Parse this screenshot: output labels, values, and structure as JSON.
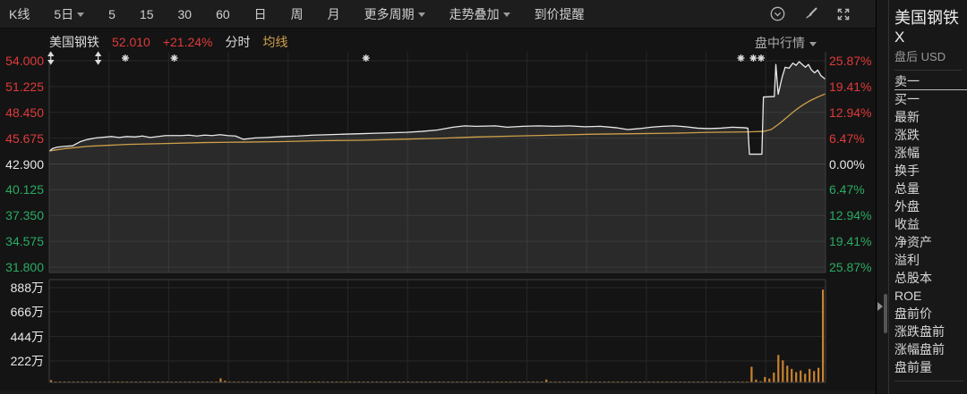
{
  "toolbar": {
    "items": [
      {
        "label": "K线",
        "chevron": false
      },
      {
        "label": "5日",
        "chevron": true
      },
      {
        "label": "5",
        "chevron": false
      },
      {
        "label": "15",
        "chevron": false
      },
      {
        "label": "30",
        "chevron": false
      },
      {
        "label": "60",
        "chevron": false
      },
      {
        "label": "日",
        "chevron": false
      },
      {
        "label": "周",
        "chevron": false
      },
      {
        "label": "月",
        "chevron": false
      },
      {
        "label": "更多周期",
        "chevron": true
      },
      {
        "label": "走势叠加",
        "chevron": true
      },
      {
        "label": "到价提醒",
        "chevron": false
      }
    ],
    "icons": [
      "notify-circle-icon",
      "brush-icon",
      "fullscreen-icon"
    ]
  },
  "chart_header": {
    "stock_name": "美国钢铁",
    "price": "52.010",
    "change_percent": "+21.24%",
    "mode_label": "分时",
    "ma_label": "均线",
    "session_view_label": "盘中行情"
  },
  "colors": {
    "up": "#e03a3a",
    "down": "#2bab63",
    "neutral": "#e8e8e8",
    "ma_line": "#cfa04a",
    "price_line": "#eaeaea",
    "volume_bar": "#c9832e"
  },
  "chart_data": {
    "type": "line",
    "title": "美国钢铁 分时 (intraday minute line)",
    "prev_close": 42.9,
    "last_price": 52.01,
    "change_percent": "+21.24%",
    "y_axis_price": [
      "54.000",
      "51.225",
      "48.450",
      "45.675",
      "42.900",
      "40.125",
      "37.350",
      "34.575",
      "31.800"
    ],
    "y_axis_percent": [
      "25.87%",
      "19.41%",
      "12.94%",
      "6.47%",
      "0.00%",
      "6.47%",
      "12.94%",
      "19.41%",
      "25.87%"
    ],
    "volume_axis_labels": [
      "888万",
      "666万",
      "444万",
      "222万"
    ],
    "ylim": [
      31.8,
      54.0
    ],
    "volume_ylim_wan": [
      0,
      888
    ],
    "grid": true,
    "price_series": [
      [
        0,
        44.25
      ],
      [
        0.004,
        44.55
      ],
      [
        0.01,
        44.7
      ],
      [
        0.02,
        44.8
      ],
      [
        0.03,
        44.85
      ],
      [
        0.04,
        45.3
      ],
      [
        0.05,
        45.55
      ],
      [
        0.06,
        45.7
      ],
      [
        0.08,
        45.85
      ],
      [
        0.09,
        45.75
      ],
      [
        0.1,
        45.85
      ],
      [
        0.11,
        45.8
      ],
      [
        0.12,
        45.9
      ],
      [
        0.13,
        45.75
      ],
      [
        0.15,
        45.95
      ],
      [
        0.17,
        45.95
      ],
      [
        0.18,
        46.0
      ],
      [
        0.19,
        45.9
      ],
      [
        0.2,
        46.0
      ],
      [
        0.21,
        45.95
      ],
      [
        0.22,
        46.05
      ],
      [
        0.23,
        45.95
      ],
      [
        0.24,
        45.9
      ],
      [
        0.25,
        45.55
      ],
      [
        0.265,
        45.7
      ],
      [
        0.28,
        45.75
      ],
      [
        0.3,
        45.85
      ],
      [
        0.32,
        45.9
      ],
      [
        0.34,
        46.0
      ],
      [
        0.36,
        46.05
      ],
      [
        0.38,
        46.1
      ],
      [
        0.4,
        46.15
      ],
      [
        0.42,
        46.2
      ],
      [
        0.44,
        46.25
      ],
      [
        0.46,
        46.3
      ],
      [
        0.48,
        46.4
      ],
      [
        0.5,
        46.55
      ],
      [
        0.52,
        46.85
      ],
      [
        0.535,
        47.0
      ],
      [
        0.55,
        46.95
      ],
      [
        0.575,
        47.0
      ],
      [
        0.59,
        46.85
      ],
      [
        0.61,
        46.95
      ],
      [
        0.63,
        47.0
      ],
      [
        0.65,
        46.95
      ],
      [
        0.67,
        47.0
      ],
      [
        0.69,
        46.9
      ],
      [
        0.71,
        46.95
      ],
      [
        0.73,
        46.8
      ],
      [
        0.745,
        46.6
      ],
      [
        0.76,
        46.7
      ],
      [
        0.775,
        46.85
      ],
      [
        0.79,
        46.95
      ],
      [
        0.805,
        47.0
      ],
      [
        0.82,
        46.9
      ],
      [
        0.835,
        46.75
      ],
      [
        0.85,
        46.7
      ],
      [
        0.865,
        46.75
      ],
      [
        0.88,
        46.85
      ],
      [
        0.895,
        46.8
      ],
      [
        0.9,
        46.75
      ],
      [
        0.902,
        43.95
      ],
      [
        0.918,
        43.95
      ],
      [
        0.92,
        50.1
      ],
      [
        0.934,
        50.15
      ],
      [
        0.936,
        53.6
      ],
      [
        0.939,
        50.4
      ],
      [
        0.944,
        52.2
      ],
      [
        0.948,
        53.3
      ],
      [
        0.953,
        53.2
      ],
      [
        0.958,
        53.75
      ],
      [
        0.962,
        53.5
      ],
      [
        0.966,
        53.9
      ],
      [
        0.97,
        53.6
      ],
      [
        0.974,
        53.3
      ],
      [
        0.978,
        53.6
      ],
      [
        0.982,
        53.0
      ],
      [
        0.986,
        52.7
      ],
      [
        0.99,
        53.0
      ],
      [
        0.994,
        52.4
      ],
      [
        1,
        52.01
      ]
    ],
    "ma_series": [
      [
        0,
        44.3
      ],
      [
        0.02,
        44.55
      ],
      [
        0.05,
        44.8
      ],
      [
        0.1,
        45.0
      ],
      [
        0.15,
        45.1
      ],
      [
        0.2,
        45.2
      ],
      [
        0.25,
        45.25
      ],
      [
        0.3,
        45.3
      ],
      [
        0.35,
        45.4
      ],
      [
        0.4,
        45.45
      ],
      [
        0.45,
        45.55
      ],
      [
        0.5,
        45.65
      ],
      [
        0.55,
        45.8
      ],
      [
        0.6,
        45.9
      ],
      [
        0.65,
        46.0
      ],
      [
        0.7,
        46.1
      ],
      [
        0.75,
        46.15
      ],
      [
        0.8,
        46.2
      ],
      [
        0.85,
        46.3
      ],
      [
        0.9,
        46.35
      ],
      [
        0.92,
        46.4
      ],
      [
        0.93,
        46.6
      ],
      [
        0.94,
        47.2
      ],
      [
        0.95,
        47.9
      ],
      [
        0.96,
        48.6
      ],
      [
        0.97,
        49.2
      ],
      [
        0.98,
        49.7
      ],
      [
        0.99,
        50.1
      ],
      [
        1,
        50.45
      ]
    ],
    "volume_bars_wan": [
      25,
      8,
      6,
      10,
      7,
      5,
      9,
      6,
      12,
      8,
      5,
      7,
      9,
      6,
      8,
      11,
      7,
      5,
      8,
      6,
      9,
      7,
      5,
      10,
      8,
      6,
      11,
      7,
      9,
      6,
      8,
      5,
      7,
      9,
      6,
      10,
      8,
      12,
      42,
      20,
      10,
      8,
      6,
      9,
      7,
      11,
      6,
      8,
      5,
      9,
      7,
      10,
      6,
      8,
      5,
      9,
      7,
      6,
      10,
      8,
      6,
      9,
      7,
      5,
      8,
      6,
      10,
      7,
      9,
      5,
      8,
      6,
      9,
      7,
      5,
      10,
      6,
      8,
      7,
      9,
      5,
      8,
      6,
      10,
      7,
      9,
      6,
      8,
      5,
      7,
      9,
      6,
      8,
      10,
      5,
      7,
      9,
      6,
      8,
      7,
      10,
      6,
      8,
      5,
      9,
      7,
      11,
      6,
      8,
      9,
      7,
      30,
      9,
      6,
      8,
      10,
      5,
      7,
      9,
      6,
      8,
      5,
      10,
      7,
      6,
      9,
      8,
      5,
      7,
      10,
      6,
      8,
      9,
      5,
      7,
      10,
      6,
      8,
      5,
      9,
      7,
      6,
      10,
      8,
      5,
      9,
      7,
      11,
      6,
      8,
      5,
      9,
      7,
      6,
      8,
      10,
      7,
      150,
      30,
      15,
      55,
      40,
      95,
      260,
      210,
      160,
      130,
      100,
      115,
      85,
      130,
      110,
      140,
      870
    ],
    "event_markers": [
      {
        "type": "updown",
        "x": 0.002
      },
      {
        "type": "updown",
        "x": 0.063
      },
      {
        "type": "star",
        "x": 0.098
      },
      {
        "type": "star",
        "x": 0.161
      },
      {
        "type": "star",
        "x": 0.408
      },
      {
        "type": "star",
        "x": 0.891
      },
      {
        "type": "star",
        "x": 0.907
      },
      {
        "type": "star",
        "x": 0.917
      }
    ],
    "legend_position": "top-left"
  },
  "sidebar": {
    "title": "美国钢铁",
    "symbol": "X",
    "session": "盘后",
    "currency": "USD",
    "fields": [
      "卖一",
      "买一",
      "最新",
      "涨跌",
      "涨幅",
      "换手",
      "总量",
      "外盘",
      "收益",
      "净资产",
      "溢利",
      "总股本",
      "ROE",
      "盘前价",
      "涨跌盘前",
      "涨幅盘前",
      "盘前量"
    ]
  }
}
